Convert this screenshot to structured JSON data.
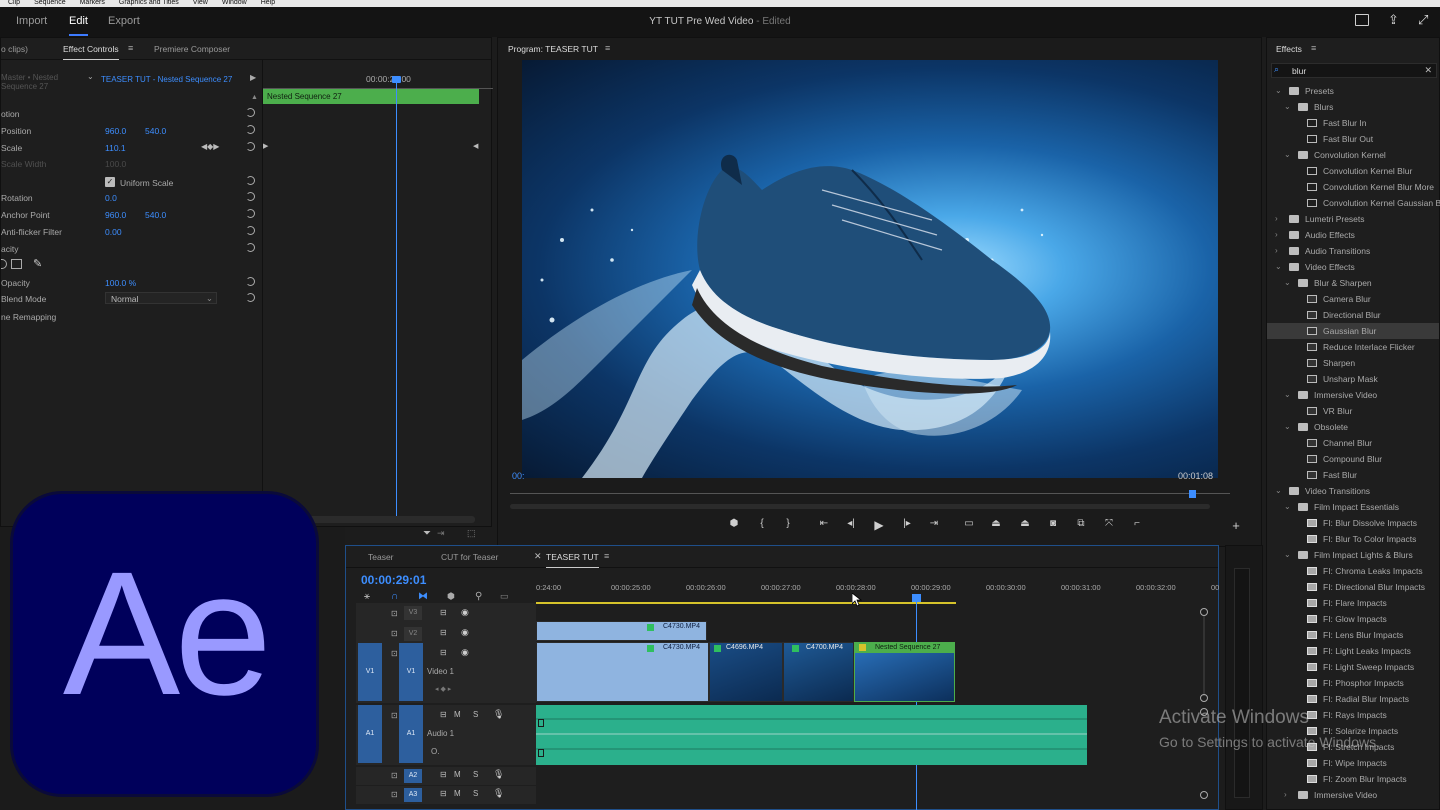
{
  "menu": [
    "Clip",
    "Sequence",
    "Markers",
    "Graphics and Titles",
    "View",
    "Window",
    "Help"
  ],
  "top_tabs": {
    "import": "Import",
    "edit": "Edit",
    "export": "Export"
  },
  "doc_title": "YT TUT Pre Wed Video",
  "doc_status": "- Edited",
  "source_panel": {
    "tab_noclips": "o clips)",
    "tab_effect_controls": "Effect Controls",
    "tab_premiere_composer": "Premiere Composer",
    "source_label": "Master • Nested Sequence 27",
    "sequence_label": "TEASER TUT - Nested Sequence 27",
    "timecode": "00:00:29:00",
    "clip_bar": "Nested Sequence 27"
  },
  "effect_controls": {
    "motion": "otion",
    "position": {
      "label": "Position",
      "x": "960.0",
      "y": "540.0"
    },
    "scale": {
      "label": "Scale",
      "value": "110.1"
    },
    "scale_width": {
      "label": "Scale Width",
      "value": "100.0"
    },
    "uniform_scale": "Uniform Scale",
    "rotation": {
      "label": "Rotation",
      "value": "0.0"
    },
    "anchor_point": {
      "label": "Anchor Point",
      "x": "960.0",
      "y": "540.0"
    },
    "anti_flicker": {
      "label": "Anti-flicker Filter",
      "value": "0.00"
    },
    "opacity_header": "acity",
    "opacity": {
      "label": "Opacity",
      "value": "100.0 %"
    },
    "blend_mode": {
      "label": "Blend Mode",
      "value": "Normal"
    },
    "time_remap": "ne Remapping"
  },
  "program": {
    "title": "Program: TEASER TUT",
    "tc_left": "00:",
    "tc_right": "00:01:08"
  },
  "effects_panel": {
    "title": "Effects",
    "search_value": "blur",
    "items": [
      {
        "indent": 0,
        "arrow": "⌄",
        "icon": "folder",
        "label": "Presets"
      },
      {
        "indent": 1,
        "arrow": "⌄",
        "icon": "folder",
        "label": "Blurs"
      },
      {
        "indent": 2,
        "arrow": "",
        "icon": "preset",
        "label": "Fast Blur In"
      },
      {
        "indent": 2,
        "arrow": "",
        "icon": "preset",
        "label": "Fast Blur Out"
      },
      {
        "indent": 1,
        "arrow": "⌄",
        "icon": "folder",
        "label": "Convolution Kernel"
      },
      {
        "indent": 2,
        "arrow": "",
        "icon": "preset",
        "label": "Convolution Kernel Blur"
      },
      {
        "indent": 2,
        "arrow": "",
        "icon": "preset",
        "label": "Convolution Kernel Blur More"
      },
      {
        "indent": 2,
        "arrow": "",
        "icon": "preset",
        "label": "Convolution Kernel Gaussian Bl"
      },
      {
        "indent": 0,
        "arrow": "›",
        "icon": "folder",
        "label": "Lumetri Presets"
      },
      {
        "indent": 0,
        "arrow": "›",
        "icon": "folder",
        "label": "Audio Effects"
      },
      {
        "indent": 0,
        "arrow": "›",
        "icon": "folder",
        "label": "Audio Transitions"
      },
      {
        "indent": 0,
        "arrow": "⌄",
        "icon": "folder",
        "label": "Video Effects"
      },
      {
        "indent": 1,
        "arrow": "⌄",
        "icon": "folder",
        "label": "Blur & Sharpen"
      },
      {
        "indent": 2,
        "arrow": "",
        "icon": "effect",
        "label": "Camera Blur"
      },
      {
        "indent": 2,
        "arrow": "",
        "icon": "effect",
        "label": "Directional Blur"
      },
      {
        "indent": 2,
        "arrow": "",
        "icon": "effect",
        "label": "Gaussian Blur",
        "selected": true
      },
      {
        "indent": 2,
        "arrow": "",
        "icon": "effect",
        "label": "Reduce Interlace Flicker"
      },
      {
        "indent": 2,
        "arrow": "",
        "icon": "effect",
        "label": "Sharpen"
      },
      {
        "indent": 2,
        "arrow": "",
        "icon": "effect",
        "label": "Unsharp Mask"
      },
      {
        "indent": 1,
        "arrow": "⌄",
        "icon": "folder",
        "label": "Immersive Video"
      },
      {
        "indent": 2,
        "arrow": "",
        "icon": "effect",
        "label": "VR Blur"
      },
      {
        "indent": 1,
        "arrow": "⌄",
        "icon": "folder",
        "label": "Obsolete"
      },
      {
        "indent": 2,
        "arrow": "",
        "icon": "effect",
        "label": "Channel Blur"
      },
      {
        "indent": 2,
        "arrow": "",
        "icon": "effect",
        "label": "Compound Blur"
      },
      {
        "indent": 2,
        "arrow": "",
        "icon": "effect",
        "label": "Fast Blur"
      },
      {
        "indent": 0,
        "arrow": "⌄",
        "icon": "folder",
        "label": "Video Transitions"
      },
      {
        "indent": 1,
        "arrow": "⌄",
        "icon": "folder",
        "label": "Film Impact Essentials"
      },
      {
        "indent": 2,
        "arrow": "",
        "icon": "trans",
        "label": "FI: Blur Dissolve Impacts"
      },
      {
        "indent": 2,
        "arrow": "",
        "icon": "trans",
        "label": "FI: Blur To Color Impacts"
      },
      {
        "indent": 1,
        "arrow": "⌄",
        "icon": "folder",
        "label": "Film Impact Lights & Blurs"
      },
      {
        "indent": 2,
        "arrow": "",
        "icon": "trans",
        "label": "FI: Chroma Leaks Impacts"
      },
      {
        "indent": 2,
        "arrow": "",
        "icon": "trans",
        "label": "FI: Directional Blur Impacts"
      },
      {
        "indent": 2,
        "arrow": "",
        "icon": "trans",
        "label": "FI: Flare Impacts"
      },
      {
        "indent": 2,
        "arrow": "",
        "icon": "trans",
        "label": "FI: Glow Impacts"
      },
      {
        "indent": 2,
        "arrow": "",
        "icon": "trans",
        "label": "FI: Lens Blur Impacts"
      },
      {
        "indent": 2,
        "arrow": "",
        "icon": "trans",
        "label": "FI: Light Leaks Impacts"
      },
      {
        "indent": 2,
        "arrow": "",
        "icon": "trans",
        "label": "FI: Light Sweep Impacts"
      },
      {
        "indent": 2,
        "arrow": "",
        "icon": "trans",
        "label": "FI: Phosphor Impacts"
      },
      {
        "indent": 2,
        "arrow": "",
        "icon": "trans",
        "label": "FI: Radial Blur Impacts"
      },
      {
        "indent": 2,
        "arrow": "",
        "icon": "trans",
        "label": "FI: Rays Impacts"
      },
      {
        "indent": 2,
        "arrow": "",
        "icon": "trans",
        "label": "FI: Solarize Impacts"
      },
      {
        "indent": 2,
        "arrow": "",
        "icon": "trans",
        "label": "FI: Stretch Impacts"
      },
      {
        "indent": 2,
        "arrow": "",
        "icon": "trans",
        "label": "FI: Wipe Impacts"
      },
      {
        "indent": 2,
        "arrow": "",
        "icon": "trans",
        "label": "FI: Zoom Blur Impacts"
      },
      {
        "indent": 1,
        "arrow": "›",
        "icon": "folder",
        "label": "Immersive Video"
      }
    ]
  },
  "timeline": {
    "tabs": [
      "Teaser",
      "CUT for Teaser",
      "TEASER TUT"
    ],
    "timecode": "00:00:29:01",
    "ruler": [
      "0:24:00",
      "00:00:25:00",
      "00:00:26:00",
      "00:00:27:00",
      "00:00:28:00",
      "00:00:29:00",
      "00:00:30:00",
      "00:00:31:00",
      "00:00:32:00",
      "00"
    ],
    "tracks": {
      "v3": "V3",
      "v2": "V2",
      "v1": "V1",
      "video1": "Video 1",
      "a1": "A1",
      "audio1": "Audio 1",
      "a2": "A2",
      "a3": "A3"
    },
    "clips": {
      "c4730_top": "C4730.MP4",
      "c4730": "C4730.MP4",
      "c4696": "C4696.MP4",
      "c4700": "C4700.MP4",
      "nested": "Nested Sequence 27"
    }
  },
  "overlay": {
    "ae_logo": "Ae",
    "activate_title": "Activate Windows",
    "activate_sub": "Go to Settings to activate Windows."
  },
  "colors": {
    "accent": "#3d8eff",
    "ae_bg": "#00005b",
    "ae_text": "#9999ff",
    "clip_green": "#4cae4c",
    "audio_green": "#2bb08c",
    "video_clip": "#8fb4e0"
  }
}
